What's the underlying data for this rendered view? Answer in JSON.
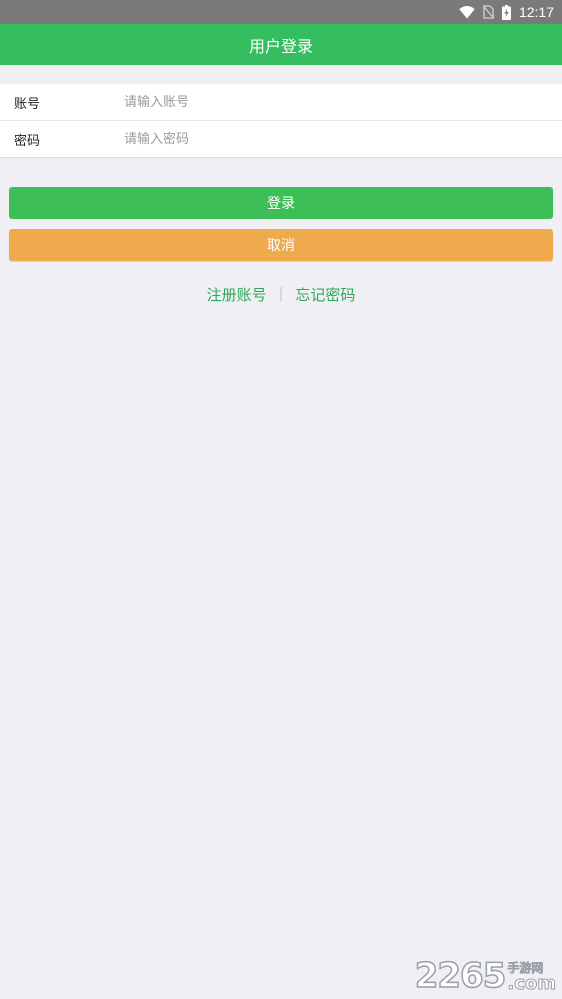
{
  "status_bar": {
    "time": "12:17",
    "icons": [
      "wifi-icon",
      "no-sim-icon",
      "battery-charging-icon"
    ]
  },
  "header": {
    "title": "用户登录"
  },
  "form": {
    "account": {
      "label": "账号",
      "placeholder": "请输入账号",
      "value": ""
    },
    "password": {
      "label": "密码",
      "placeholder": "请输入密码",
      "value": ""
    }
  },
  "buttons": {
    "login_label": "登录",
    "cancel_label": "取消"
  },
  "links": {
    "register": "注册账号",
    "separator": "|",
    "forgot": "忘记密码"
  },
  "watermark": {
    "digits": "2265",
    "cn": "手游网",
    "suffix": ".com"
  },
  "colors": {
    "header_bg": "#34be60",
    "login_button": "#3ebe56",
    "cancel_button": "#efaa4e",
    "link": "#2fa85a",
    "page_bg": "#efeff4",
    "status_bar_bg": "#7a7a7a"
  }
}
